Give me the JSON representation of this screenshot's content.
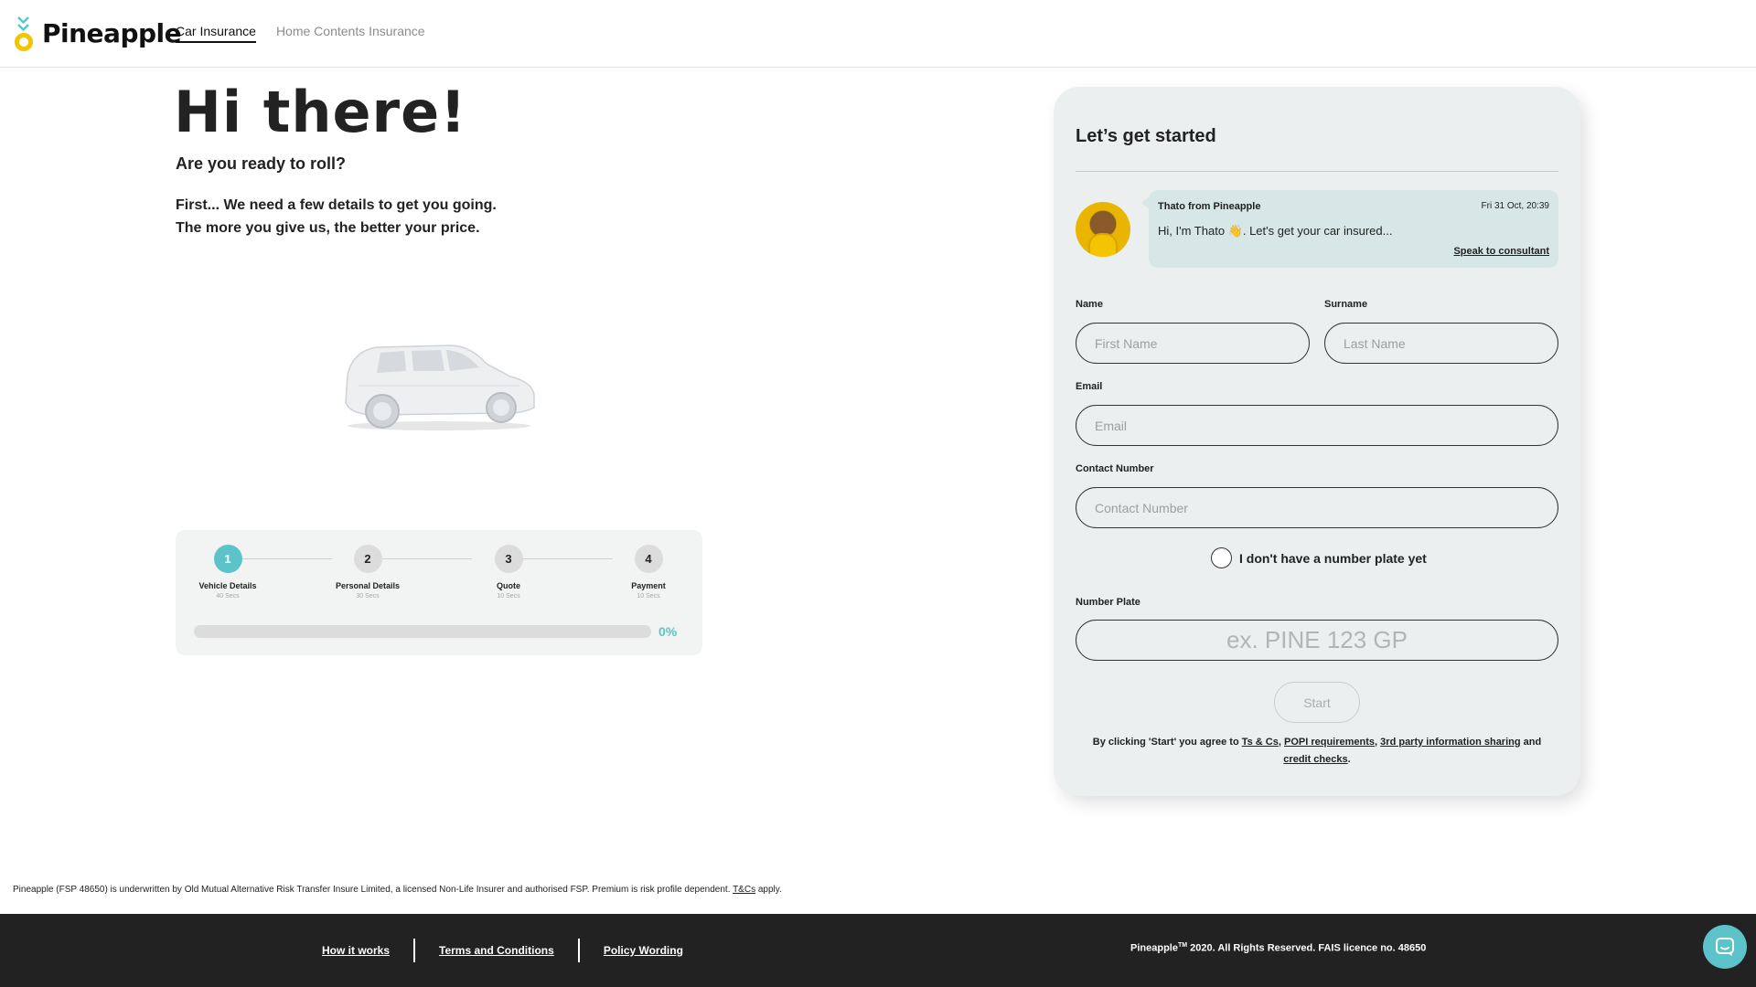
{
  "header": {
    "logo_text": "Pineapple",
    "nav": [
      {
        "label": "Car Insurance",
        "active": true
      },
      {
        "label": "Home Contents Insurance",
        "active": false
      }
    ]
  },
  "hero": {
    "title": "Hi there!",
    "subtitle": "Are you ready to roll?",
    "desc_line1": "First... We need a few details to get you going.",
    "desc_line2": "The more you give us, the better your price."
  },
  "steps": {
    "items": [
      {
        "number": "1",
        "name": "Vehicle Details",
        "time": "40 Secs",
        "active": true
      },
      {
        "number": "2",
        "name": "Personal Details",
        "time": "30 Secs",
        "active": false
      },
      {
        "number": "3",
        "name": "Quote",
        "time": "10 Secs",
        "active": false
      },
      {
        "number": "4",
        "name": "Payment",
        "time": "10 Secs",
        "active": false
      }
    ],
    "progress_percent": 0,
    "progress_label": "0%"
  },
  "form": {
    "title": "Let’s get started",
    "chat": {
      "sender": "Thato from Pineapple",
      "timestamp": "Fri 31 Oct, 20:39",
      "message": "Hi, I'm Thato 👋. Let's get your car insured...",
      "link": "Speak to consultant"
    },
    "name_label": "Name",
    "name_placeholder": "First Name",
    "surname_label": "Surname",
    "surname_placeholder": "Last Name",
    "email_label": "Email",
    "email_placeholder": "Email",
    "contact_label": "Contact Number",
    "contact_placeholder": "Contact Number",
    "no_plate_label": "I don't have a number plate yet",
    "plate_label": "Number Plate",
    "plate_placeholder": "ex. PINE 123 GP",
    "start_label": "Start",
    "terms_prefix": "By clicking 'Start' you agree to",
    "terms_link1": "Ts & Cs",
    "terms_link2": "POPI requirements",
    "terms_link3": "3rd party information sharing",
    "terms_and": "and",
    "terms_link4": "credit checks"
  },
  "disclaimer": {
    "text": "Pineapple (FSP 48650) is underwritten by Old Mutual Alternative Risk Transfer Insure Limited, a licensed Non-Life Insurer and authorised FSP. Premium is risk profile dependent.",
    "link": "T&Cs",
    "suffix": "apply."
  },
  "footer": {
    "links": [
      "How it works",
      "Terms and Conditions",
      "Policy Wording"
    ],
    "copy_brand": "Pineapple",
    "copy_tm": "TM",
    "copy_rest": "2020. All Rights Reserved. FAIS licence no. 48650"
  },
  "colors": {
    "accent": "#5cc3ca",
    "brand_yellow": "#f2c500",
    "footer_bg": "#222222"
  }
}
